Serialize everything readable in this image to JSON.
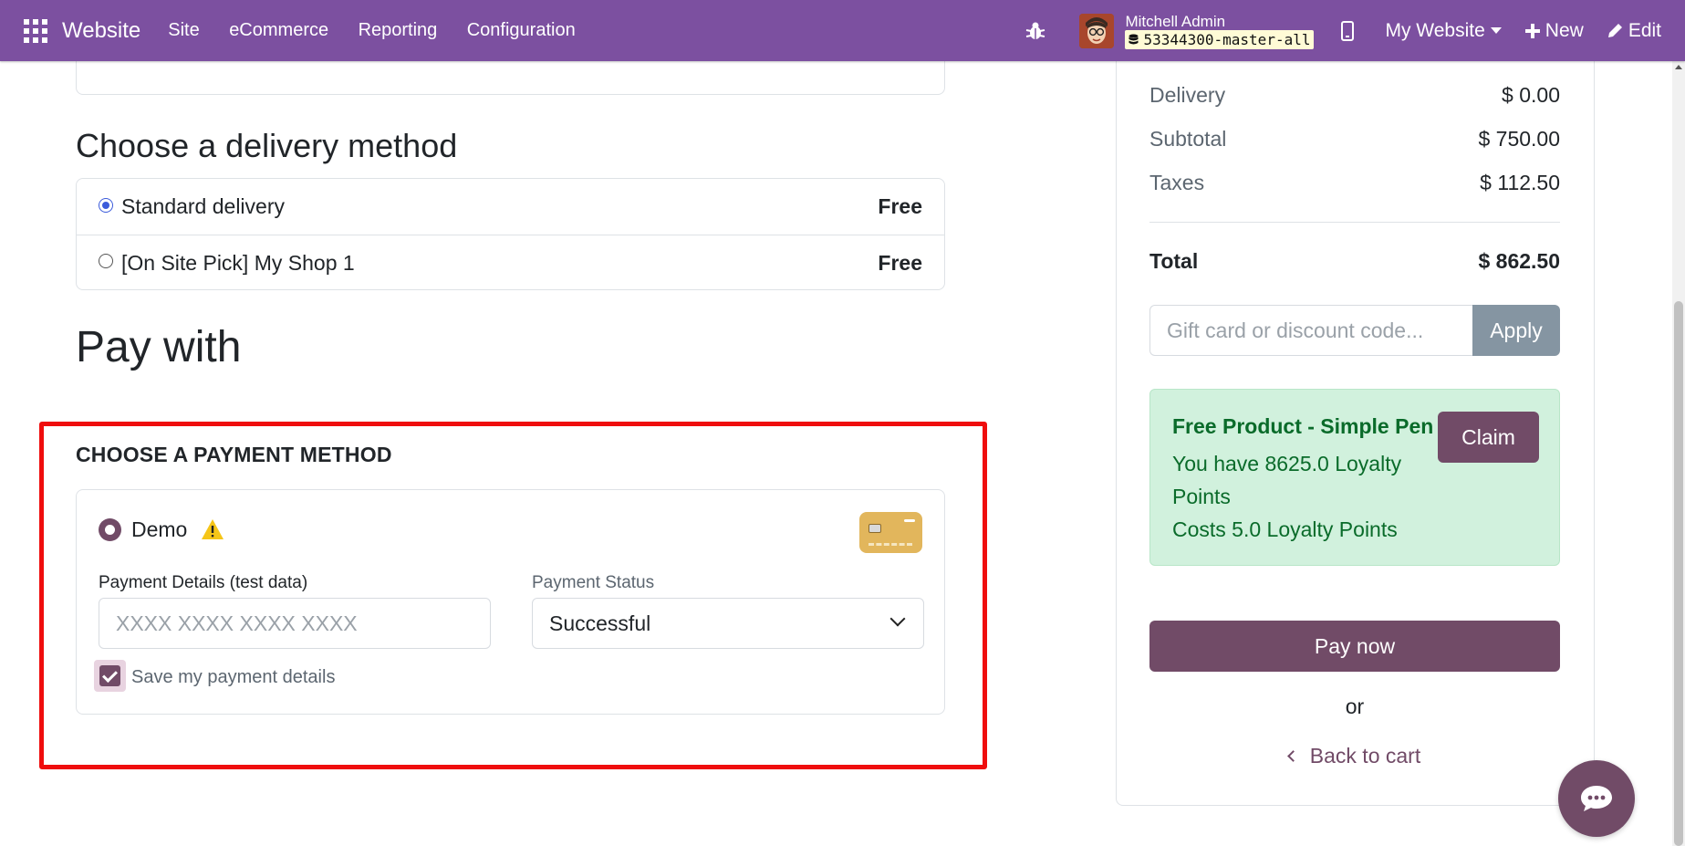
{
  "topbar": {
    "brand": "Website",
    "menu": [
      "Site",
      "eCommerce",
      "Reporting",
      "Configuration"
    ],
    "user_name": "Mitchell Admin",
    "db_name": "53344300-master-all",
    "website_selector": "My Website",
    "new_label": "New",
    "edit_label": "Edit",
    "icons": [
      "apps-grid-icon",
      "bug-icon",
      "mobile-icon",
      "plus-icon",
      "pencil-icon"
    ]
  },
  "delivery": {
    "title": "Choose a delivery method",
    "options": [
      {
        "label": "Standard delivery",
        "price": "Free",
        "selected": true
      },
      {
        "label": "[On Site Pick] My Shop 1",
        "price": "Free",
        "selected": false
      }
    ]
  },
  "payment": {
    "section_title": "Pay with",
    "choose_title": "CHOOSE A PAYMENT METHOD",
    "method_label": "Demo",
    "details_label": "Payment Details (test data)",
    "details_placeholder": "XXXX XXXX XXXX XXXX",
    "status_label": "Payment Status",
    "status_value": "Successful",
    "save_label": "Save my payment details",
    "save_checked": true
  },
  "summary": {
    "rows": [
      {
        "label": "Delivery",
        "value": "$ 0.00"
      },
      {
        "label": "Subtotal",
        "value": "$ 750.00"
      },
      {
        "label": "Taxes",
        "value": "$ 112.50"
      }
    ],
    "total_label": "Total",
    "total_value": "$ 862.50",
    "promo_placeholder": "Gift card or discount code...",
    "apply_label": "Apply",
    "reward": {
      "title": "Free Product - Simple Pen",
      "points_text": "You have 8625.0 Loyalty Points",
      "cost_text": "Costs 5.0 Loyalty Points",
      "claim_label": "Claim"
    },
    "pay_now_label": "Pay now",
    "or_text": "or",
    "back_label": "Back to cart"
  },
  "colors": {
    "navbar": "#7c50a0",
    "primary": "#714b67",
    "highlight": "#ef0d0d",
    "reward_bg": "#d1f1dd",
    "reward_text": "#0a6b2a"
  }
}
